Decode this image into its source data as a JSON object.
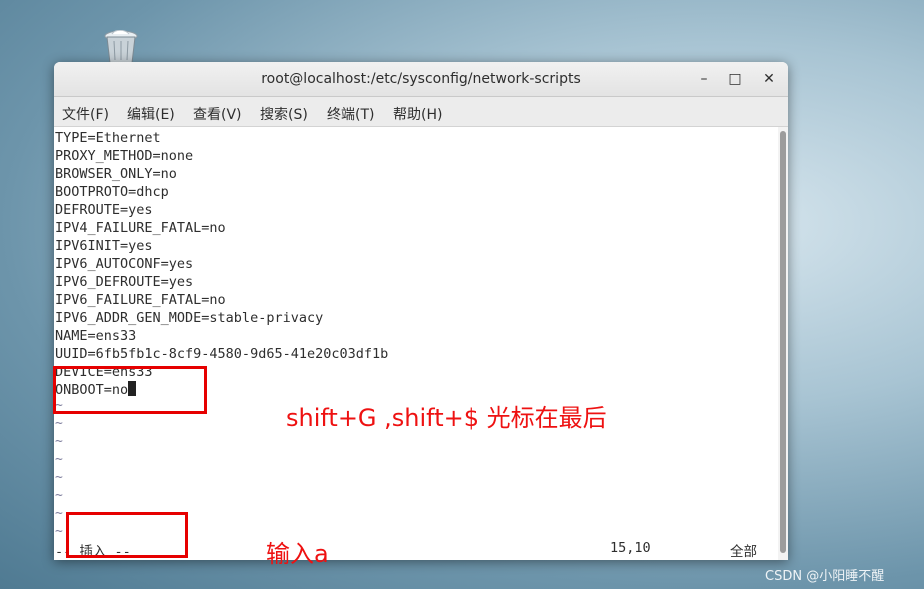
{
  "window": {
    "title": "root@localhost:/etc/sysconfig/network-scripts",
    "minimize_glyph": "–",
    "maximize_glyph": "□",
    "close_glyph": "✕"
  },
  "menu": [
    {
      "label": "文件(F)"
    },
    {
      "label": "编辑(E)"
    },
    {
      "label": "查看(V)"
    },
    {
      "label": "搜索(S)"
    },
    {
      "label": "终端(T)"
    },
    {
      "label": "帮助(H)"
    }
  ],
  "editor": {
    "lines": [
      "TYPE=Ethernet",
      "PROXY_METHOD=none",
      "BROWSER_ONLY=no",
      "BOOTPROTO=dhcp",
      "DEFROUTE=yes",
      "IPV4_FAILURE_FATAL=no",
      "IPV6INIT=yes",
      "IPV6_AUTOCONF=yes",
      "IPV6_DEFROUTE=yes",
      "IPV6_FAILURE_FATAL=no",
      "IPV6_ADDR_GEN_MODE=stable-privacy",
      "NAME=ens33",
      "UUID=6fb5fb1c-8cf9-4580-9d65-41e20c03df1b",
      "DEVICE=ens33",
      "ONBOOT=no"
    ],
    "tilde": "~",
    "status_mode": "-- 插入 --",
    "status_position": "15,10",
    "status_scroll": "全部"
  },
  "annotations": {
    "note1": "shift+G ,shift+$ 光标在最后",
    "note2": "输入a"
  },
  "desktop": {
    "icon": "trash-icon"
  },
  "watermark": "CSDN @小阳睡不醒",
  "colors": {
    "annotation": "#ee1111",
    "terminal_bg": "#ffffff",
    "text": "#2e2e2e"
  }
}
